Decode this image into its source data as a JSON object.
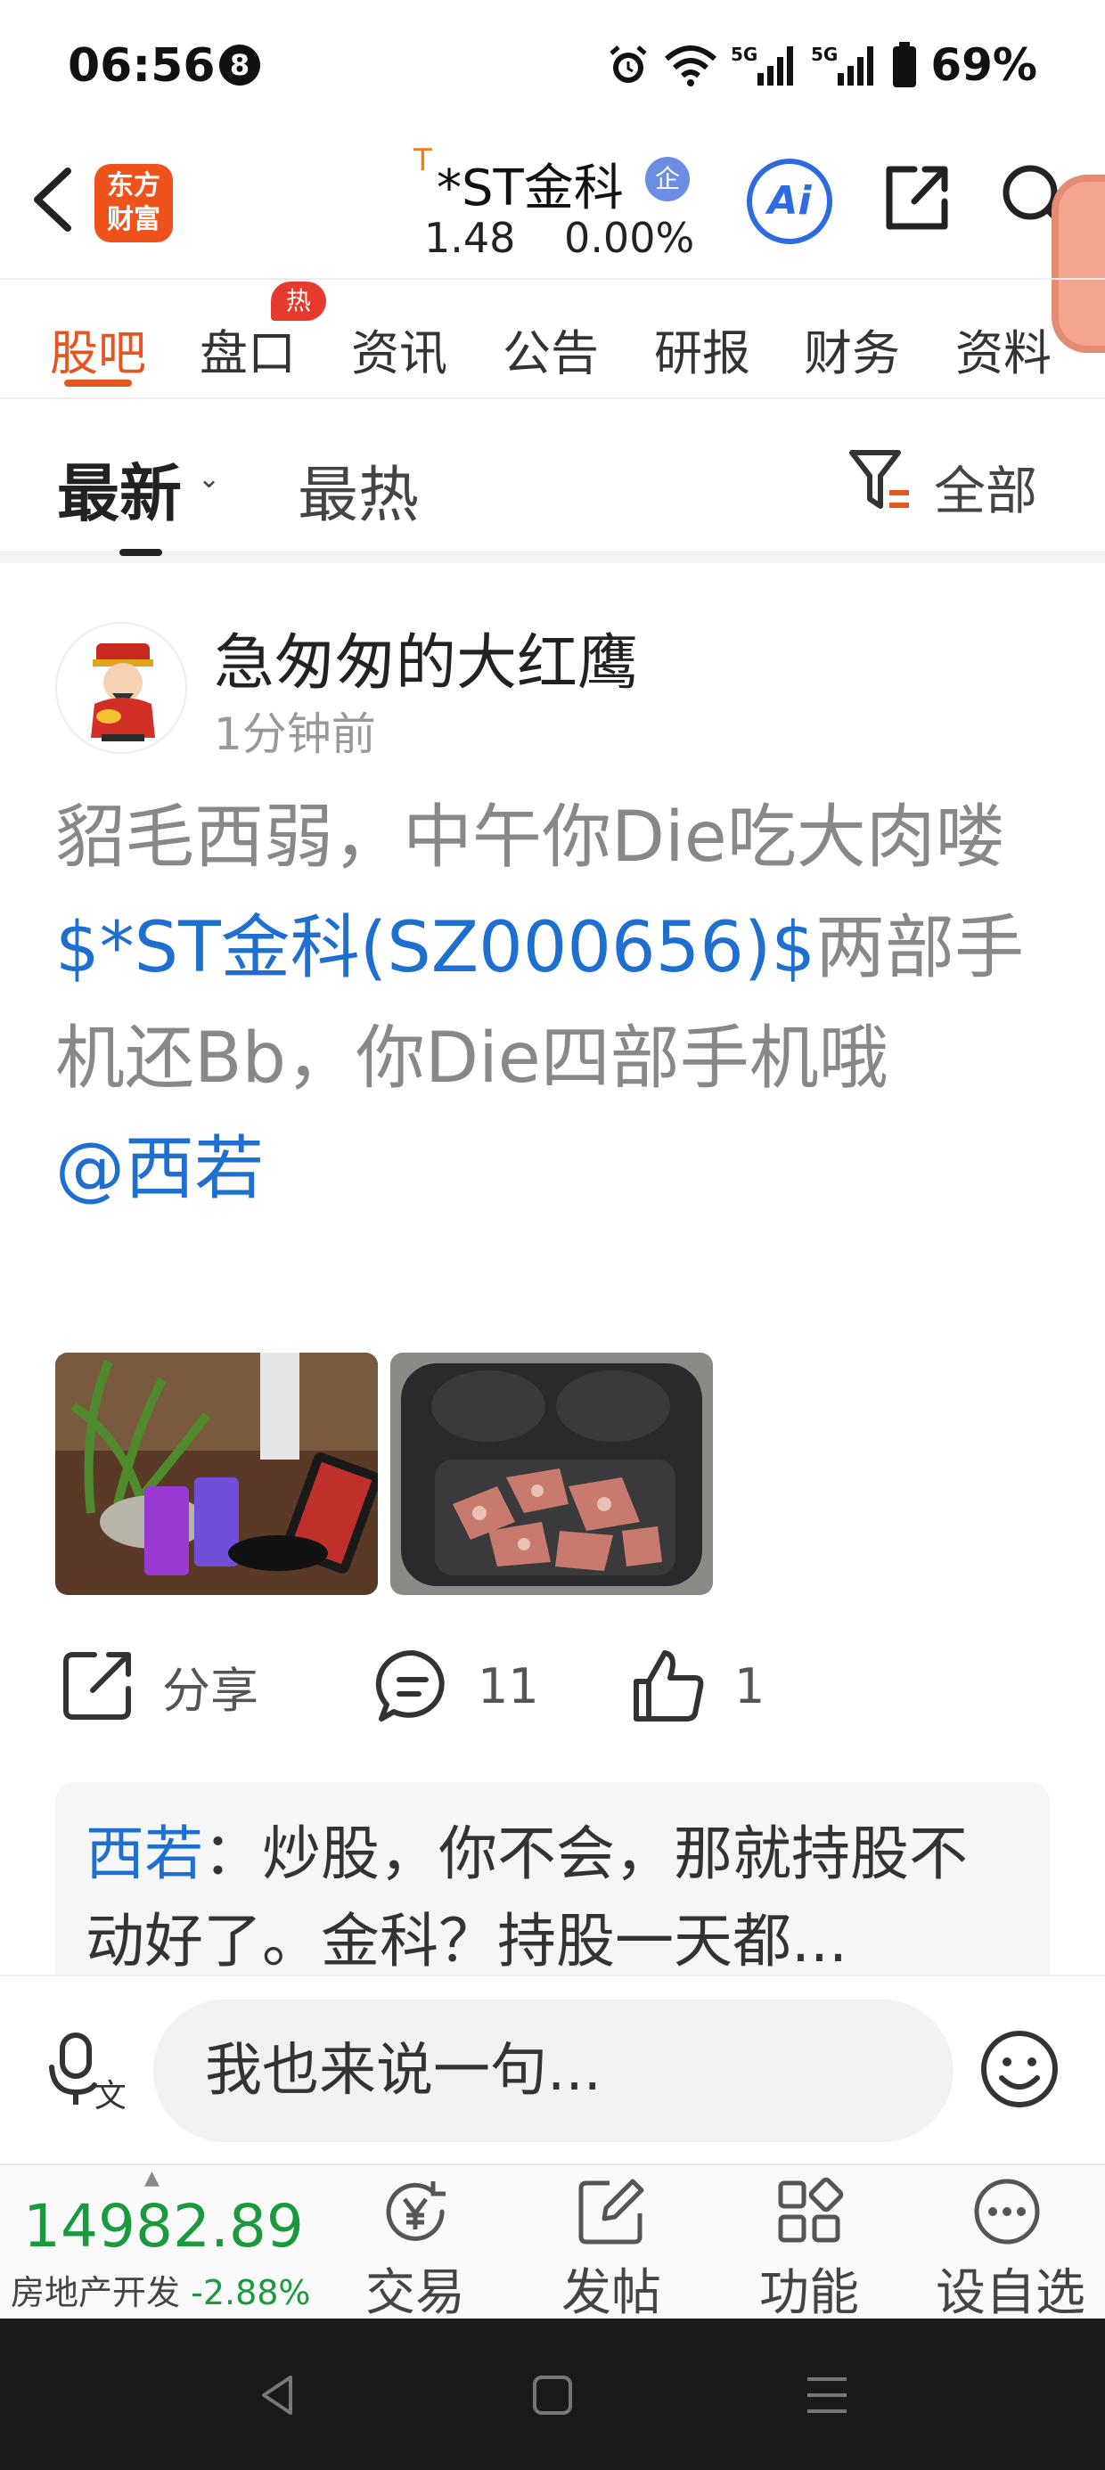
{
  "status_bar": {
    "time": "06:56",
    "notification_count": "8",
    "network_1": "5G",
    "network_2": "5G",
    "battery": "69%"
  },
  "header": {
    "logo_line1": "东方",
    "logo_line2": "财富",
    "t_mark": "T",
    "stock_name": "*ST金科",
    "verify_badge": "企",
    "price": "1.48",
    "change_pct": "0.00%",
    "ai_label": "Ai"
  },
  "tabs": [
    {
      "label": "股吧",
      "active": true
    },
    {
      "label": "盘口",
      "active": false
    },
    {
      "label": "资讯",
      "active": false
    },
    {
      "label": "公告",
      "active": false
    },
    {
      "label": "研报",
      "active": false
    },
    {
      "label": "财务",
      "active": false
    },
    {
      "label": "资料",
      "active": false
    }
  ],
  "hot_badge": "热",
  "sort": {
    "latest": "最新",
    "hot": "最热",
    "filter": "全部"
  },
  "post": {
    "username": "急匆匆的大红鹰",
    "time": "1分钟前",
    "text_1": "貂毛西弱，中午你Die吃大肉喽",
    "stock_link": "$*ST金科(SZ000656)$",
    "text_2": "两部手机还Bb，你Die四部手机哦",
    "mention": "@西若",
    "actions": {
      "share": "分享",
      "comments": "11",
      "likes": "1"
    },
    "comment_preview": {
      "author": "西若",
      "text": "：炒股，你不会，那就持股不动好了。金科？持股一天都..."
    }
  },
  "input_bar": {
    "placeholder": "我也来说一句..."
  },
  "bottom_bar": {
    "index_value": "14982.89",
    "index_name": "房地产开发",
    "index_change": "-2.88%",
    "nav": [
      {
        "label": "交易",
        "icon": "yen-refresh-icon"
      },
      {
        "label": "发帖",
        "icon": "edit-icon"
      },
      {
        "label": "功能",
        "icon": "grid-icon"
      },
      {
        "label": "设自选",
        "icon": "more-dots-icon"
      }
    ]
  },
  "colors": {
    "accent": "#e8541e",
    "link": "#1e6fd0",
    "down": "#1a9a3c"
  }
}
